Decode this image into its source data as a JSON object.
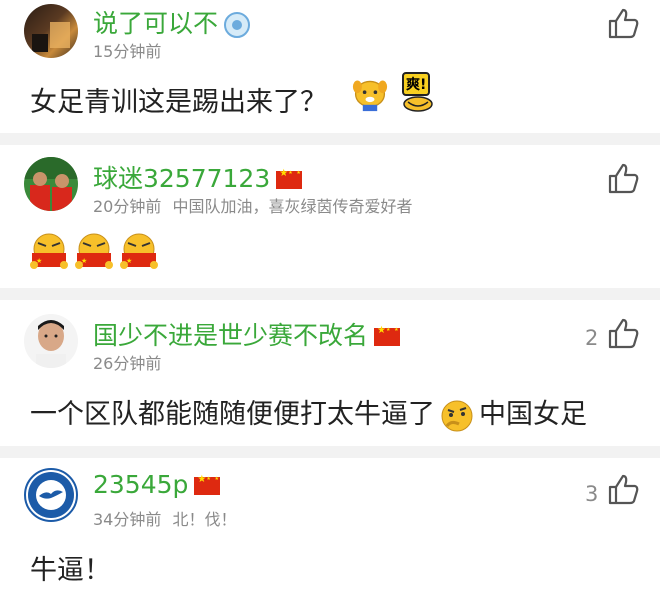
{
  "comments": [
    {
      "username": "说了可以不",
      "time": "15分钟前",
      "extra": "",
      "text": "女足青训这是踢出来了？",
      "likes": "",
      "badge": "club-crest-icon"
    },
    {
      "username": "球迷32577123",
      "time": "20分钟前",
      "extra": "中国队加油，喜灰绿茵传奇爱好者",
      "text": "",
      "likes": "",
      "badge": "china-flag-icon"
    },
    {
      "username": "国少不进是世少赛不改名",
      "time": "26分钟前",
      "extra": "",
      "text": "一个区队都能随随便便打太牛逼了",
      "text_after": "中国女足",
      "likes": "2",
      "badge": "china-flag-icon"
    },
    {
      "username": "23545p",
      "time": "34分钟前",
      "extra": "北！伐！",
      "text": "牛逼！",
      "likes": "3",
      "badge": "china-flag-icon"
    }
  ],
  "emoji_labels": {
    "shuang": "爽!"
  },
  "colors": {
    "username": "#3aa83a",
    "meta": "#8a8a8a",
    "divider": "#f2f2f2"
  }
}
